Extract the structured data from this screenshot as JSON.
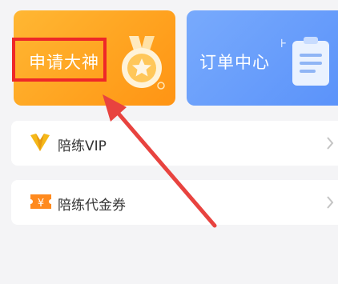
{
  "cards": {
    "apply": {
      "title": "申请大神"
    },
    "orders": {
      "title": "订单中心"
    }
  },
  "rows": {
    "vip": {
      "label": "陪练VIP"
    },
    "coupon": {
      "label": "陪练代金券"
    }
  },
  "colors": {
    "apply_card": "#ffa21f",
    "orders_card": "#5a92fa",
    "highlight": "#ee2828",
    "arrow": "#e8433f"
  },
  "icons": [
    "medal-icon",
    "clipboard-icon",
    "vip-crown-icon",
    "coupon-ticket-icon",
    "chevron-right-icon"
  ]
}
